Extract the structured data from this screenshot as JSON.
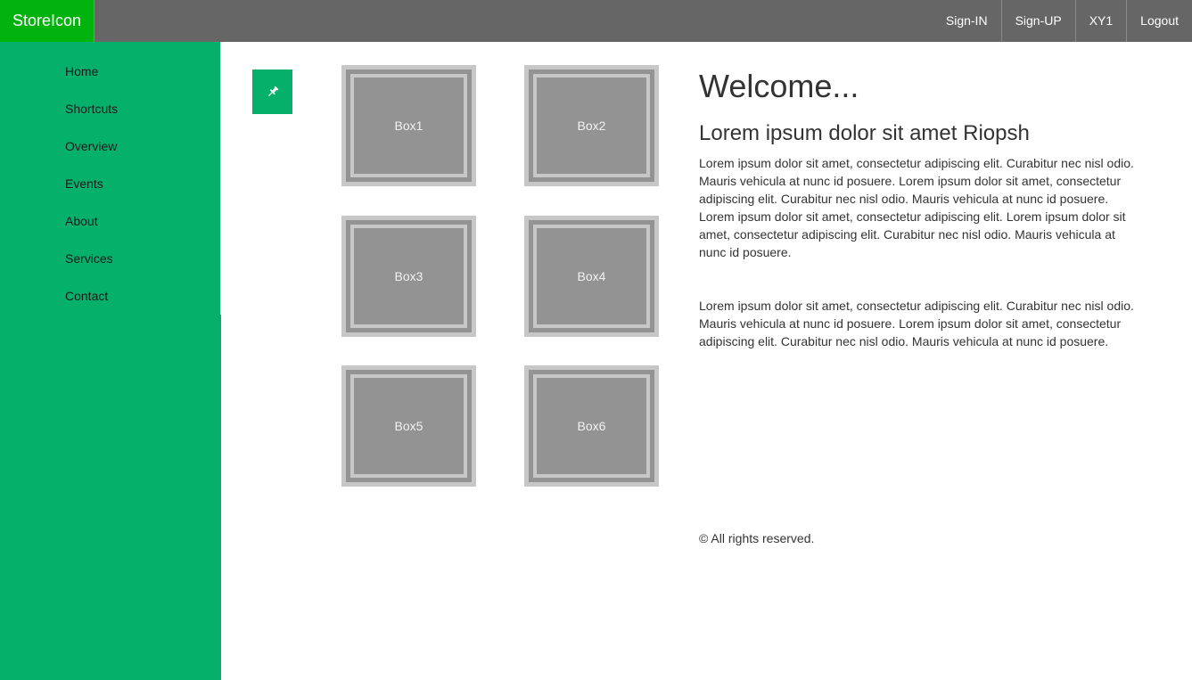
{
  "brand": {
    "name": "StoreIcon"
  },
  "topnav": {
    "items": [
      {
        "label": "Sign-IN"
      },
      {
        "label": "Sign-UP"
      },
      {
        "label": "XY1"
      },
      {
        "label": "Logout"
      }
    ]
  },
  "sidebar": {
    "items": [
      {
        "label": "Home"
      },
      {
        "label": "Shortcuts"
      },
      {
        "label": "Overview"
      },
      {
        "label": "Events"
      },
      {
        "label": "About"
      },
      {
        "label": "Services"
      },
      {
        "label": "Contact"
      }
    ]
  },
  "pin": {
    "icon": "pin-icon"
  },
  "boxes": [
    {
      "label": "Box1"
    },
    {
      "label": "Box2"
    },
    {
      "label": "Box3"
    },
    {
      "label": "Box4"
    },
    {
      "label": "Box5"
    },
    {
      "label": "Box6"
    }
  ],
  "main": {
    "title": "Welcome...",
    "subtitle": "Lorem ipsum dolor sit amet Riopsh",
    "paragraphs": [
      "Lorem ipsum dolor sit amet, consectetur adipiscing elit. Curabitur nec nisl odio. Mauris vehicula at nunc id posuere. Lorem ipsum dolor sit amet, consectetur adipiscing elit. Curabitur nec nisl odio. Mauris vehicula at nunc id posuere. Lorem ipsum dolor sit amet, consectetur adipiscing elit. Lorem ipsum dolor sit amet, consectetur adipiscing elit. Curabitur nec nisl odio. Mauris vehicula at nunc id posuere.",
      "Lorem ipsum dolor sit amet, consectetur adipiscing elit. Curabitur nec nisl odio. Mauris vehicula at nunc id posuere. Lorem ipsum dolor sit amet, consectetur adipiscing elit. Curabitur nec nisl odio. Mauris vehicula at nunc id posuere."
    ],
    "footer": "© All rights reserved."
  },
  "colors": {
    "brand_bg": "#02b20d",
    "topbar_bg": "#666666",
    "sidebar_bg": "#05b06b",
    "box_outer": "#c7c7c7",
    "box_inner": "#939393"
  }
}
